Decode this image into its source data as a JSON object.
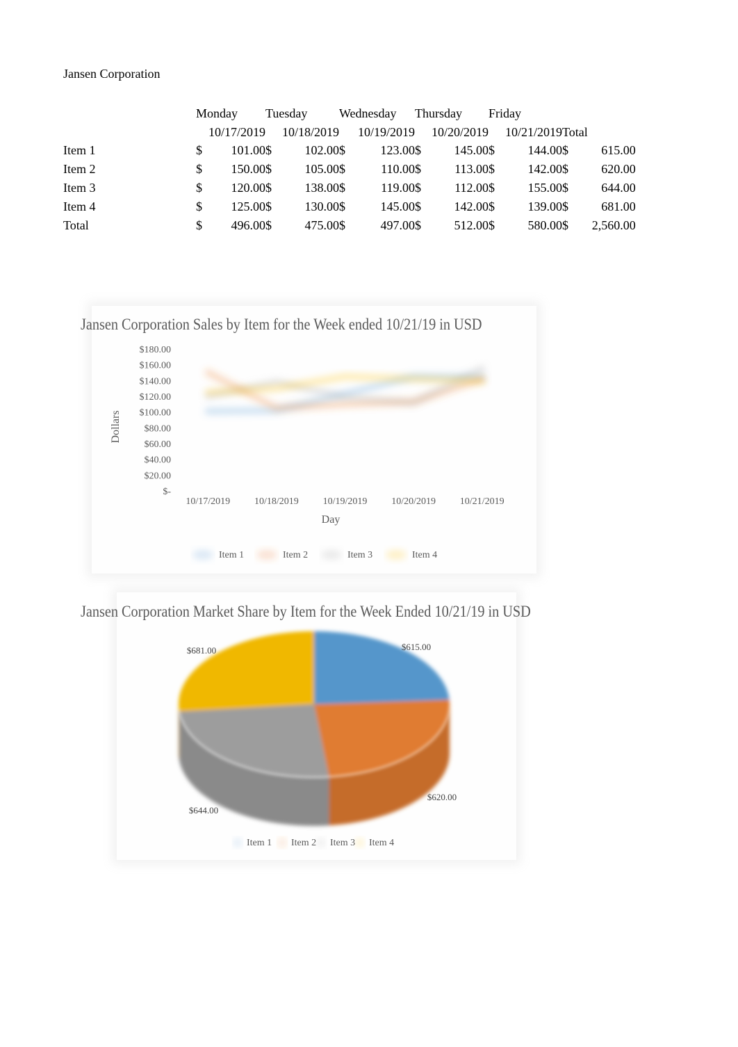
{
  "document": {
    "company": "Jansen Corporation"
  },
  "table": {
    "days": [
      "Monday",
      "Tuesday",
      "Wednesday",
      "Thursday",
      "Friday"
    ],
    "dates": [
      "10/17/2019",
      "10/18/2019",
      "10/19/2019",
      "10/20/2019",
      "10/21/2019"
    ],
    "total_header": "Total",
    "currency": "$",
    "rows": [
      {
        "label": "Item 1",
        "values": [
          "101.00",
          "102.00",
          "123.00",
          "145.00",
          "144.00"
        ],
        "total": "615.00"
      },
      {
        "label": "Item 2",
        "values": [
          "150.00",
          "105.00",
          "110.00",
          "113.00",
          "142.00"
        ],
        "total": "620.00"
      },
      {
        "label": "Item 3",
        "values": [
          "120.00",
          "138.00",
          "119.00",
          "112.00",
          "155.00"
        ],
        "total": "644.00"
      },
      {
        "label": "Item 4",
        "values": [
          "125.00",
          "130.00",
          "145.00",
          "142.00",
          "139.00"
        ],
        "total": "681.00"
      },
      {
        "label": "Total",
        "values": [
          "496.00",
          "475.00",
          "497.00",
          "512.00",
          "580.00"
        ],
        "total": "2,560.00"
      }
    ]
  },
  "chart_data": [
    {
      "type": "line",
      "title": "Jansen Corporation Sales by Item for the Week ended 10/21/19 in USD",
      "xlabel": "Day",
      "ylabel": "Dollars",
      "categories": [
        "10/17/2019",
        "10/18/2019",
        "10/19/2019",
        "10/20/2019",
        "10/21/2019"
      ],
      "ylim": [
        0,
        180
      ],
      "yticks": [
        0,
        20,
        40,
        60,
        80,
        100,
        120,
        140,
        160,
        180
      ],
      "ytick_labels": [
        "$-",
        "$20.00",
        "$40.00",
        "$60.00",
        "$80.00",
        "$100.00",
        "$120.00",
        "$140.00",
        "$160.00",
        "$180.00"
      ],
      "grid": false,
      "legend_position": "bottom",
      "series": [
        {
          "name": "Item 1",
          "values": [
            101,
            102,
            123,
            145,
            144
          ],
          "color": "#5b9bd5"
        },
        {
          "name": "Item 2",
          "values": [
            150,
            105,
            110,
            113,
            142
          ],
          "color": "#ed7d31"
        },
        {
          "name": "Item 3",
          "values": [
            120,
            138,
            119,
            112,
            155
          ],
          "color": "#a5a5a5"
        },
        {
          "name": "Item 4",
          "values": [
            125,
            130,
            145,
            142,
            139
          ],
          "color": "#ffc000"
        }
      ]
    },
    {
      "type": "pie",
      "title": "Jansen Corporation Market Share by Item for the Week Ended 10/21/19 in USD",
      "legend_position": "bottom",
      "labels": [
        "Item 1",
        "Item 2",
        "Item 3",
        "Item 4"
      ],
      "values": [
        615,
        620,
        644,
        681
      ],
      "data_labels": [
        "$615.00",
        "$620.00",
        "$644.00",
        "$681.00"
      ],
      "colors": [
        "#5596cb",
        "#e07b30",
        "#9d9d9d",
        "#f0b800"
      ]
    }
  ]
}
